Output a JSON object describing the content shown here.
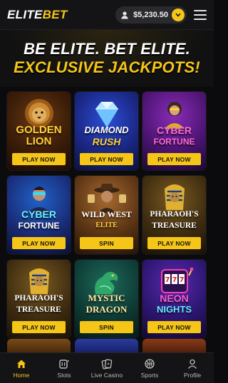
{
  "header": {
    "logo_left": "ELITE",
    "logo_right": "BET",
    "balance": "$5,230.50"
  },
  "hero": {
    "line1": "BE ELITE. BET ELITE.",
    "line2": "EXCLUSIVE JACKPOTS!"
  },
  "games": [
    {
      "title_line1": "GOLDEN",
      "title_line2": "LION",
      "button": "PLAY NOW"
    },
    {
      "title_line1": "DIAMOND",
      "title_line2": "RUSH",
      "button": "PLAY NOW"
    },
    {
      "title_line1": "CYBER",
      "title_line2": "FORTUNE",
      "button": "PLAY NOW"
    },
    {
      "title_line1": "CYBER",
      "title_line2": "FORTUNE",
      "button": "PLAY NOW"
    },
    {
      "title_line1": "WILD WEST",
      "title_line2": "ELITE",
      "button": "SPIN"
    },
    {
      "title_line1": "PHARAOH'S",
      "title_line2": "TREASURE",
      "button": "PLAY NOW"
    },
    {
      "title_line1": "PHARAOH'S",
      "title_line2": "TREASURE",
      "button": "PLAY NOW"
    },
    {
      "title_line1": "MYSTIC",
      "title_line2": "DRAGON",
      "button": "SPIN"
    },
    {
      "title_line1": "NEON",
      "title_line2": "NIGHTS",
      "button": "PLAY NOW"
    }
  ],
  "nav": {
    "items": [
      {
        "label": "Home",
        "icon": "home-icon",
        "active": true
      },
      {
        "label": "Slots",
        "icon": "slots-icon"
      },
      {
        "label": "Live Casino",
        "icon": "cards-icon"
      },
      {
        "label": "Sports",
        "icon": "ball-icon"
      },
      {
        "label": "Profile",
        "icon": "profile-icon"
      }
    ]
  },
  "colors": {
    "accent": "#f5c518",
    "background": "#0b0b0d",
    "header": "#141416"
  }
}
